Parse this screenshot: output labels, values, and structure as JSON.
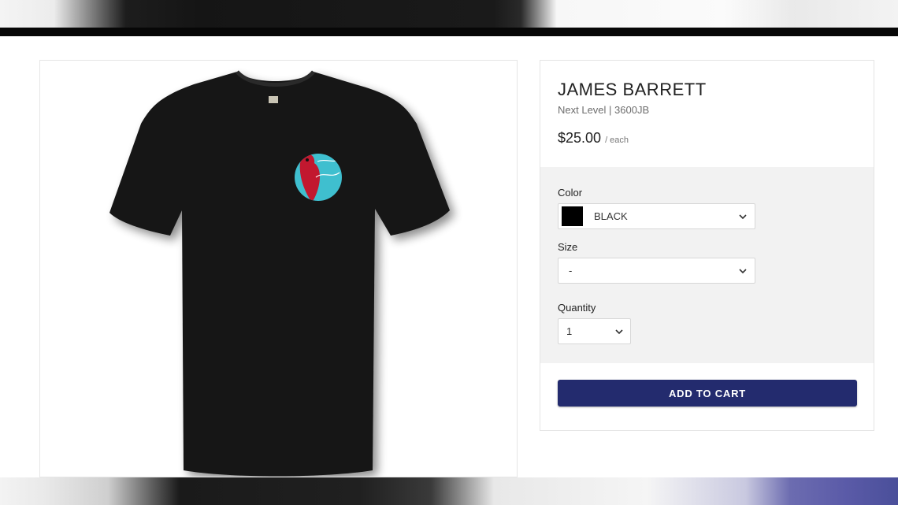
{
  "product": {
    "title": "JAMES BARRETT",
    "subtitle": "Next Level | 3600JB",
    "price": "$25.00",
    "price_unit": "/ each",
    "image_description_icon": "tshirt-image"
  },
  "options": {
    "color": {
      "label": "Color",
      "selected": "BLACK",
      "swatch": "#000000"
    },
    "size": {
      "label": "Size",
      "selected": "-"
    },
    "quantity": {
      "label": "Quantity",
      "selected": "1"
    }
  },
  "cart": {
    "button_label": "ADD TO CART",
    "button_color": "#232b6e"
  },
  "colors": {
    "accent": "#232b6e",
    "logo_teal": "#3fbfcf",
    "cardinal_red": "#c2182f"
  }
}
